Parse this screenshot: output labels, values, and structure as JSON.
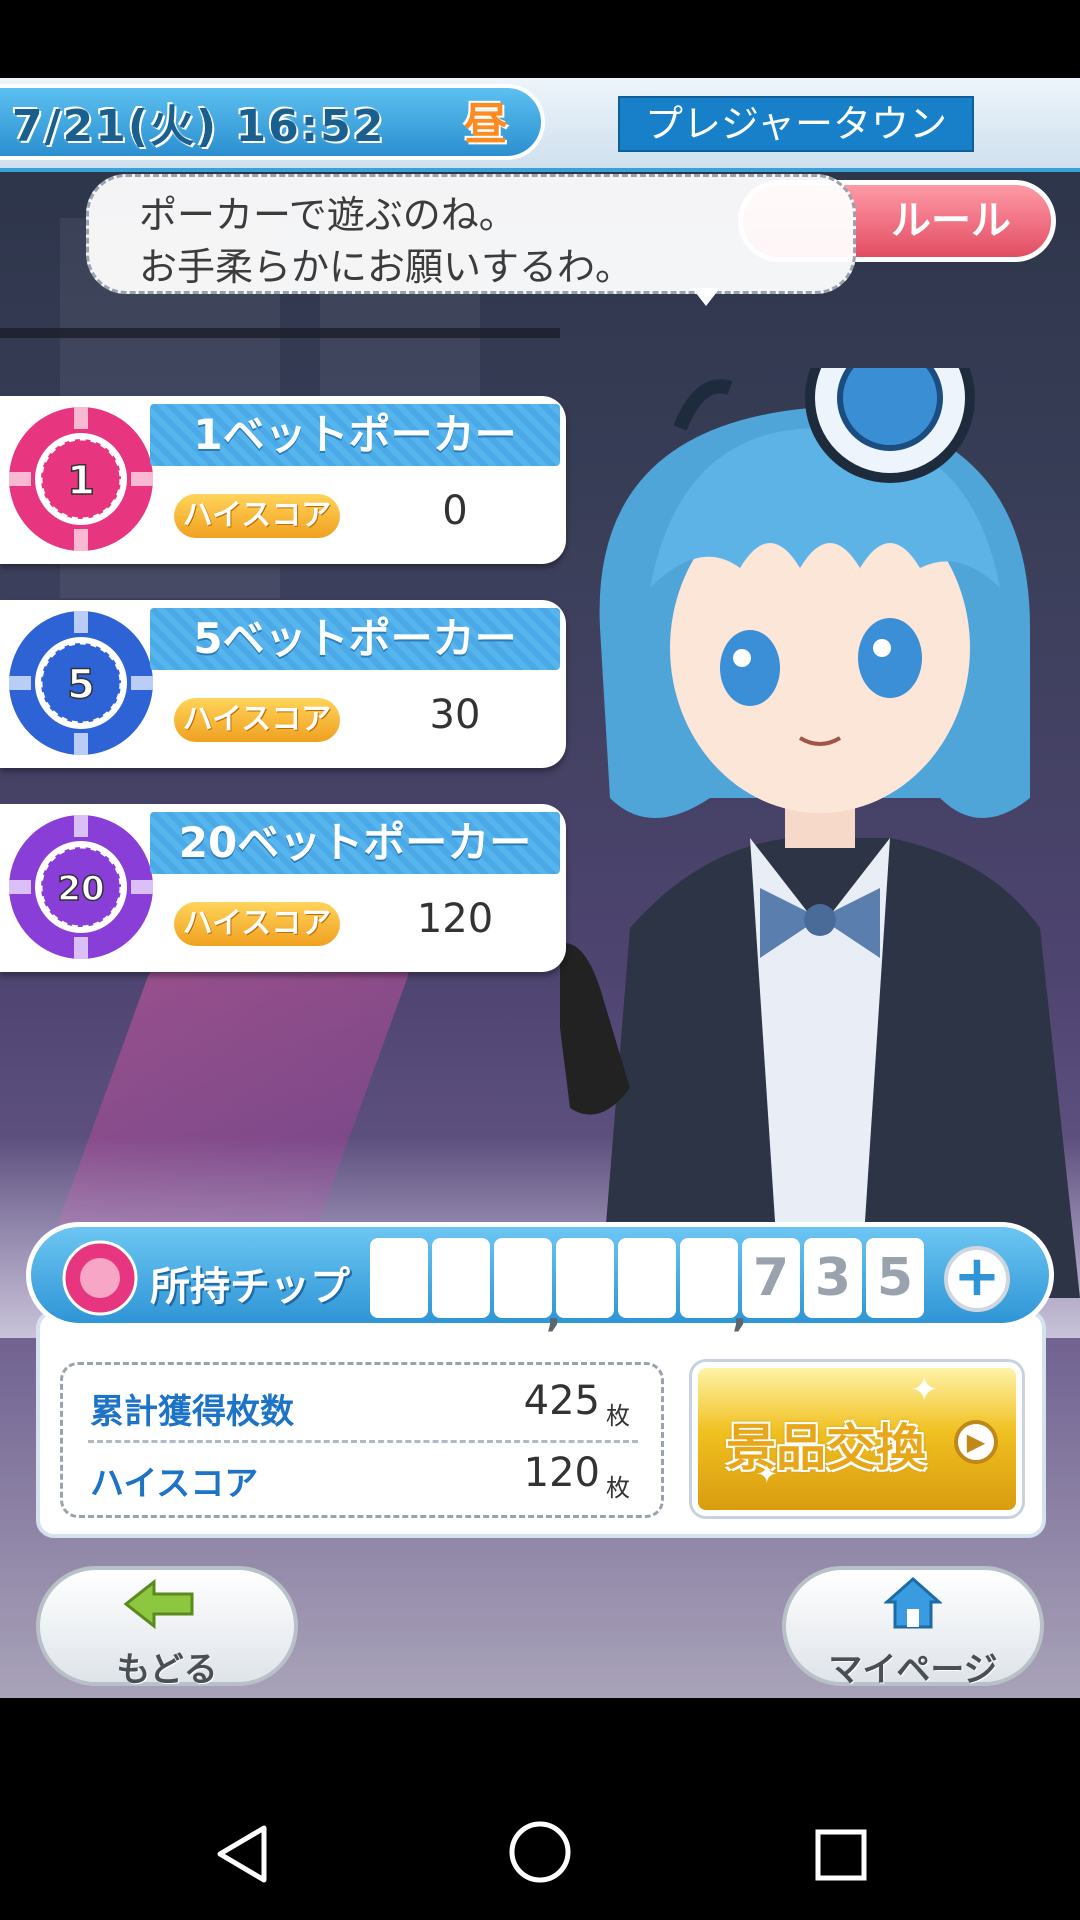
{
  "header": {
    "datetime": "7/21(火) 16:52",
    "daytime": "昼",
    "location": "プレジャータウン"
  },
  "rule_button": {
    "label": "ルール"
  },
  "speech": {
    "lines": [
      "ポーカーで遊ぶのね。",
      "お手柔らかにお願いするわ。"
    ]
  },
  "poker_modes": [
    {
      "chip": "1",
      "title": "1ベットポーカー",
      "highscore_label": "ハイスコア",
      "highscore": "0",
      "color": "#e8357f"
    },
    {
      "chip": "5",
      "title": "5ベットポーカー",
      "highscore_label": "ハイスコア",
      "highscore": "30",
      "color": "#2e63d6"
    },
    {
      "chip": "20",
      "title": "20ベットポーカー",
      "highscore_label": "ハイスコア",
      "highscore": "120",
      "color": "#8a3ed8"
    }
  ],
  "chips": {
    "label": "所持チップ",
    "digits": [
      "",
      "",
      "",
      "",
      "",
      "",
      "7",
      "3",
      "5"
    ],
    "add_label": "+"
  },
  "stats": {
    "total_label": "累計獲得枚数",
    "total_value": "425",
    "highscore_label": "ハイスコア",
    "highscore_value": "120",
    "unit": "枚"
  },
  "exchange": {
    "label": "景品交換",
    "arrow": "▶"
  },
  "nav": {
    "back_label": "もどる",
    "mypage_label": "マイページ"
  },
  "colors": {
    "accent_blue": "#2f95d6",
    "rule_red": "#e24d63",
    "gold": "#f0c020"
  }
}
